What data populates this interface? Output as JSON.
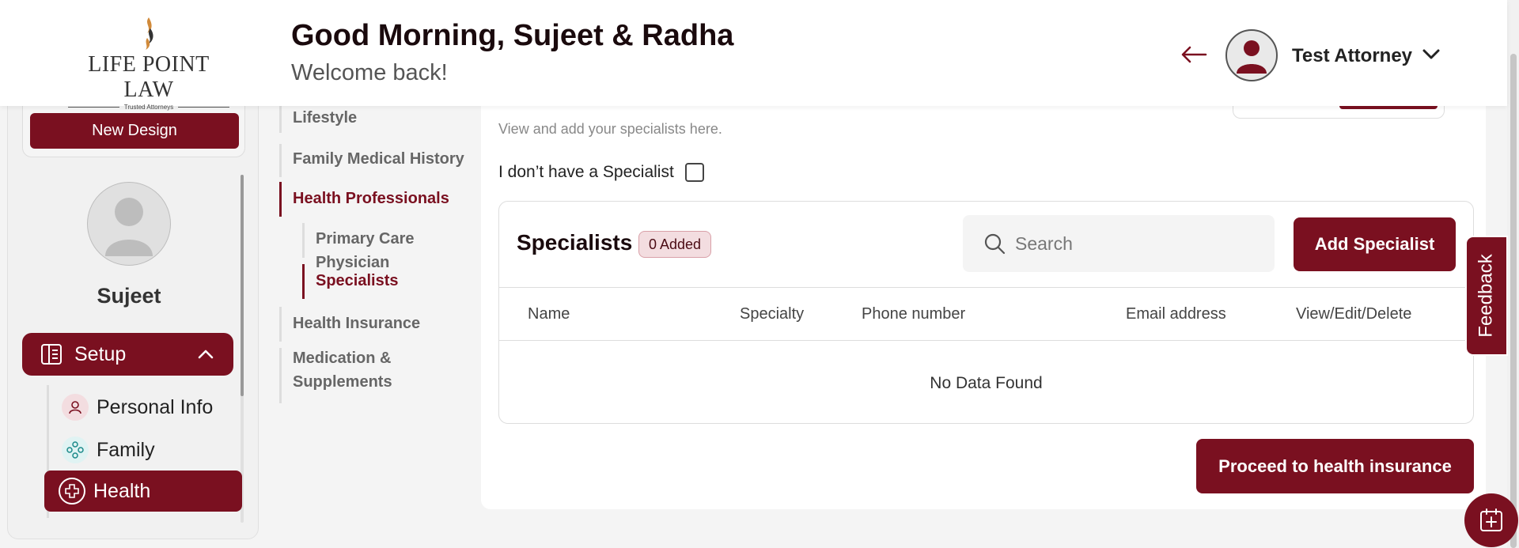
{
  "header": {
    "logo_name": "LIFE POINT LAW",
    "logo_tagline": "Trusted Attorneys",
    "greeting": "Good Morning, Sujeet & Radha",
    "welcome": "Welcome back!",
    "user_name": "Test Attorney"
  },
  "sidebar": {
    "new_design_label": "New Design",
    "profile_name": "Sujeet",
    "setup_label": "Setup",
    "items": [
      {
        "label": "Personal Info",
        "icon": "person-icon"
      },
      {
        "label": "Family",
        "icon": "family-icon"
      },
      {
        "label": "Health",
        "icon": "health-plus-icon",
        "active": true
      }
    ]
  },
  "health_nav": {
    "items": [
      {
        "label": "Lifestyle"
      },
      {
        "label": "Family Medical History"
      },
      {
        "label": "Health Professionals",
        "active": true
      },
      {
        "label": "Primary Care Physician",
        "sub": true
      },
      {
        "label": "Specialists",
        "sub": true,
        "active": true
      },
      {
        "label": "Health Insurance"
      },
      {
        "label": "Medication &"
      },
      {
        "label": "Supplements"
      }
    ]
  },
  "main": {
    "description": "View and add your specialists here.",
    "no_specialist_label": "I don’t have a Specialist",
    "no_specialist_checked": false,
    "card_title": "Specialists",
    "added_badge": "0 Added",
    "search_placeholder": "Search",
    "add_button": "Add Specialist",
    "columns": [
      "Name",
      "Specialty",
      "Phone number",
      "Email address",
      "View/Edit/Delete"
    ],
    "empty_text": "No Data Found",
    "proceed_button": "Proceed to health insurance"
  },
  "feedback_label": "Feedback",
  "colors": {
    "brand": "#7a1020",
    "badge_bg": "#f3dde0"
  }
}
